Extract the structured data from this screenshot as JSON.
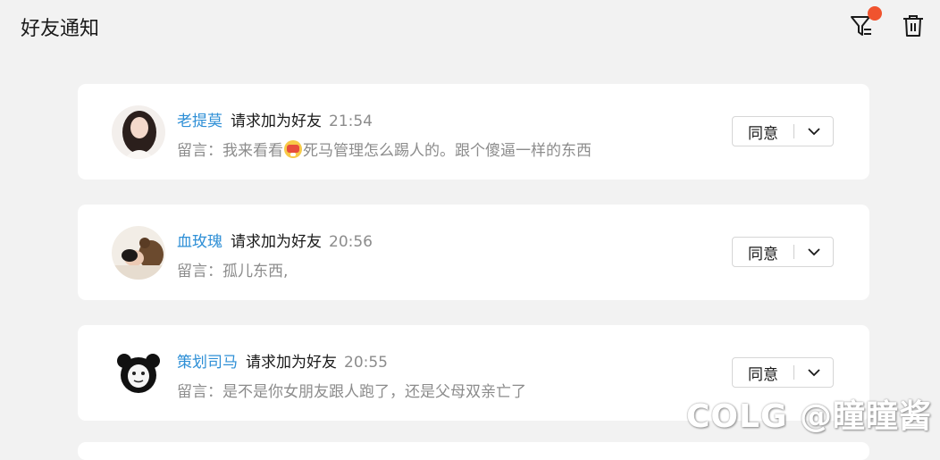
{
  "header": {
    "title": "好友通知"
  },
  "notifications": [
    {
      "name": "老提莫",
      "action": "请求加为好友",
      "time": "21:54",
      "message_before": "留言：我来看看",
      "message_after": "死马管理怎么踢人的。跟个傻逼一样的东西",
      "agree_label": "同意"
    },
    {
      "name": "血玫瑰",
      "action": "请求加为好友",
      "time": "20:56",
      "message_before": "留言：孤儿东西,",
      "message_after": "",
      "agree_label": "同意"
    },
    {
      "name": "策划司马",
      "action": "请求加为好友",
      "time": "20:55",
      "message_before": "留言：是不是你女朋友跟人跑了，还是父母双亲亡了",
      "message_after": "",
      "agree_label": "同意"
    }
  ],
  "watermark": "COLG @瞳瞳酱",
  "colors": {
    "background": "#f2f2f2",
    "card": "#ffffff",
    "name_link": "#2e8fd6",
    "muted": "#8c8c8c",
    "badge": "#f0532e"
  },
  "icons": [
    "filter-icon",
    "trash-icon",
    "chevron-down-icon",
    "clown-emoji-icon"
  ]
}
